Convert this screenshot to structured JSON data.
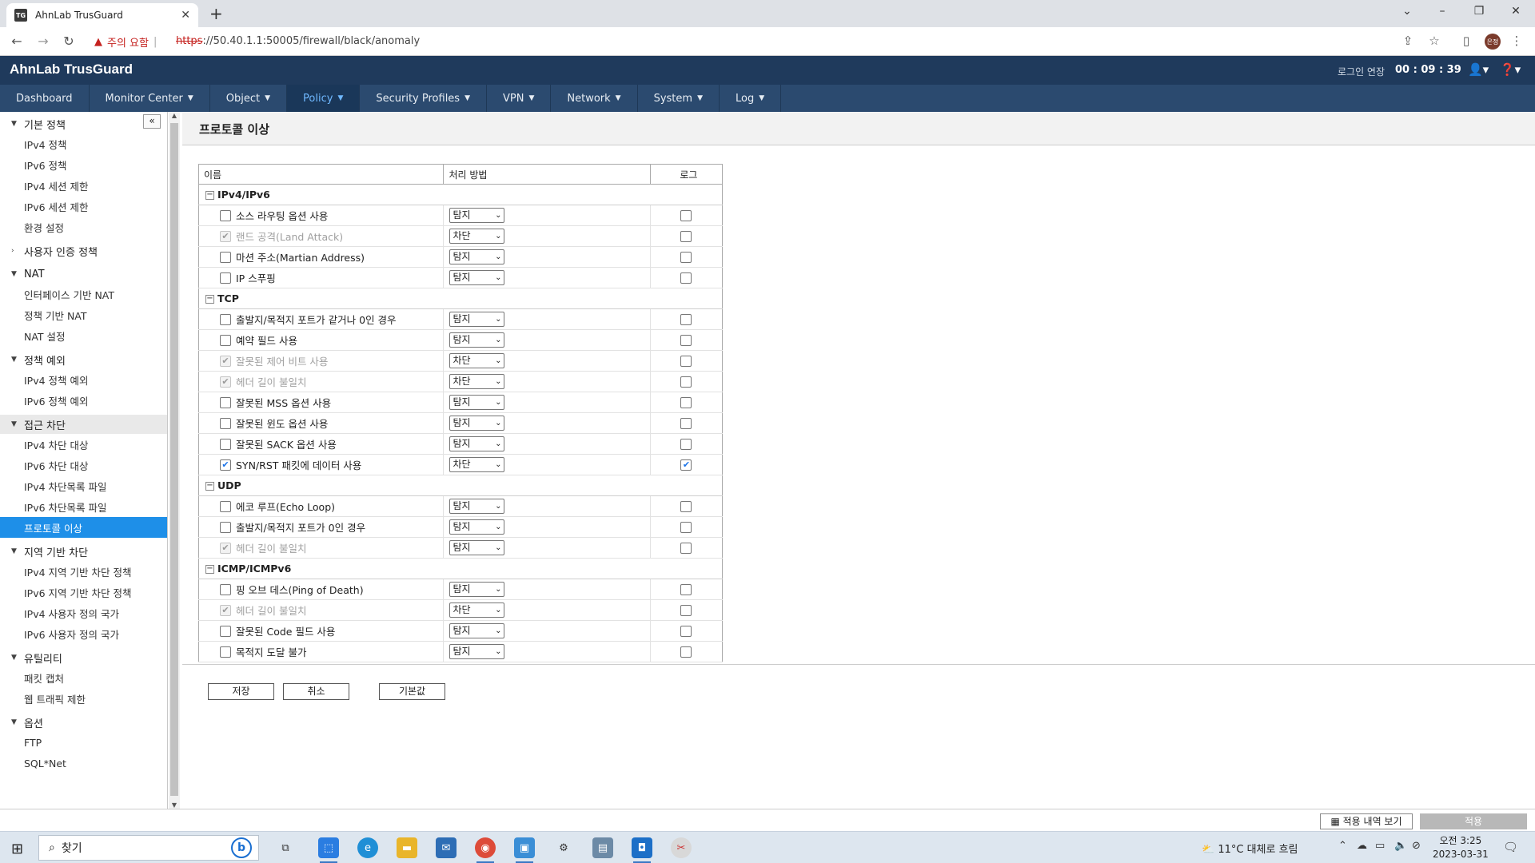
{
  "browser": {
    "tab_title": "AhnLab TrusGuard",
    "tab_favicon": "TG",
    "security_warning": "주의 요함",
    "url_scheme": "https",
    "url_rest": "://50.40.1.1:50005/firewall/black/anomaly",
    "profile": "은정"
  },
  "app": {
    "brand": "AhnLab TrusGuard",
    "relogin_label": "로그인 연장",
    "timer": "00 : 09 : 39"
  },
  "menu": [
    {
      "label": "Dashboard",
      "dropdown": false
    },
    {
      "label": "Monitor Center",
      "dropdown": true
    },
    {
      "label": "Object",
      "dropdown": true
    },
    {
      "label": "Policy",
      "dropdown": true,
      "active": true
    },
    {
      "label": "Security Profiles",
      "dropdown": true
    },
    {
      "label": "VPN",
      "dropdown": true
    },
    {
      "label": "Network",
      "dropdown": true
    },
    {
      "label": "System",
      "dropdown": true
    },
    {
      "label": "Log",
      "dropdown": true
    }
  ],
  "sidebar": {
    "collapse_label": "«",
    "groups": [
      {
        "label": "기본 정책",
        "expanded": true,
        "items": [
          "IPv4 정책",
          "IPv6 정책",
          "IPv4 세션 제한",
          "IPv6 세션 제한",
          "환경 설정"
        ]
      },
      {
        "label": "사용자 인증 정책",
        "expanded": false,
        "items": []
      },
      {
        "label": "NAT",
        "expanded": true,
        "items": [
          "인터페이스 기반 NAT",
          "정책 기반 NAT",
          "NAT 설정"
        ]
      },
      {
        "label": "정책 예외",
        "expanded": true,
        "items": [
          "IPv4 정책 예외",
          "IPv6 정책 예외"
        ]
      },
      {
        "label": "접근 차단",
        "expanded": true,
        "highlight": true,
        "items": [
          "IPv4 차단 대상",
          "IPv6 차단 대상",
          "IPv4 차단목록 파일",
          "IPv6 차단목록 파일",
          "프로토콜 이상"
        ],
        "active_item": "프로토콜 이상"
      },
      {
        "label": "지역 기반 차단",
        "expanded": true,
        "items": [
          "IPv4 지역 기반 차단 정책",
          "IPv6 지역 기반 차단 정책",
          "IPv4 사용자 정의 국가",
          "IPv6 사용자 정의 국가"
        ]
      },
      {
        "label": "유틸리티",
        "expanded": true,
        "items": [
          "패킷 캡처",
          "웹 트래픽 제한"
        ]
      },
      {
        "label": "옵션",
        "expanded": true,
        "items": [
          "FTP",
          "SQL*Net"
        ]
      }
    ]
  },
  "page": {
    "title": "프로토콜 이상",
    "columns": {
      "name": "이름",
      "action": "처리 방법",
      "log": "로그"
    },
    "sections": [
      {
        "label": "IPv4/IPv6",
        "rows": [
          {
            "name": "소스 라우팅 옵션 사용",
            "checked": false,
            "disabled": false,
            "action": "탐지",
            "log": false
          },
          {
            "name": "랜드 공격(Land Attack)",
            "checked": true,
            "disabled": true,
            "action": "차단",
            "log": false
          },
          {
            "name": "마션 주소(Martian Address)",
            "checked": false,
            "disabled": false,
            "action": "탐지",
            "log": false
          },
          {
            "name": "IP 스푸핑",
            "checked": false,
            "disabled": false,
            "action": "탐지",
            "log": false
          }
        ]
      },
      {
        "label": "TCP",
        "rows": [
          {
            "name": "출발지/목적지 포트가 같거나 0인 경우",
            "checked": false,
            "disabled": false,
            "action": "탐지",
            "log": false
          },
          {
            "name": "예약 필드 사용",
            "checked": false,
            "disabled": false,
            "action": "탐지",
            "log": false
          },
          {
            "name": "잘못된 제어 비트 사용",
            "checked": true,
            "disabled": true,
            "action": "차단",
            "log": false
          },
          {
            "name": "헤더 길이 불일치",
            "checked": true,
            "disabled": true,
            "action": "차단",
            "log": false
          },
          {
            "name": "잘못된 MSS 옵션 사용",
            "checked": false,
            "disabled": false,
            "action": "탐지",
            "log": false
          },
          {
            "name": "잘못된 윈도 옵션 사용",
            "checked": false,
            "disabled": false,
            "action": "탐지",
            "log": false
          },
          {
            "name": "잘못된 SACK 옵션 사용",
            "checked": false,
            "disabled": false,
            "action": "탐지",
            "log": false
          },
          {
            "name": "SYN/RST 패킷에 데이터 사용",
            "checked": true,
            "disabled": false,
            "action": "차단",
            "log": true
          }
        ]
      },
      {
        "label": "UDP",
        "rows": [
          {
            "name": "에코 루프(Echo Loop)",
            "checked": false,
            "disabled": false,
            "action": "탐지",
            "log": false
          },
          {
            "name": "출발지/목적지 포트가 0인 경우",
            "checked": false,
            "disabled": false,
            "action": "탐지",
            "log": false
          },
          {
            "name": "헤더 길이 불일치",
            "checked": true,
            "disabled": true,
            "action": "탐지",
            "log": false
          }
        ]
      },
      {
        "label": "ICMP/ICMPv6",
        "rows": [
          {
            "name": "핑 오브 데스(Ping of Death)",
            "checked": false,
            "disabled": false,
            "action": "탐지",
            "log": false
          },
          {
            "name": "헤더 길이 불일치",
            "checked": true,
            "disabled": true,
            "action": "차단",
            "log": false
          },
          {
            "name": "잘못된 Code 필드 사용",
            "checked": false,
            "disabled": false,
            "action": "탐지",
            "log": false
          },
          {
            "name": "목적지 도달 불가",
            "checked": false,
            "disabled": false,
            "action": "탐지",
            "log": false
          }
        ]
      }
    ],
    "buttons": {
      "save": "저장",
      "cancel": "취소",
      "default": "기본값"
    }
  },
  "action_bar": {
    "history": "적용 내역 보기",
    "apply": "적용"
  },
  "taskbar": {
    "search_placeholder": "찾기",
    "weather": "11°C 대체로 흐림",
    "time": "오전 3:25",
    "date": "2023-03-31"
  },
  "colors": {
    "header_bg": "#1f3a5c",
    "menu_bg": "#2b4a6f",
    "active_menu_text": "#6fb8ff",
    "sidebar_active": "#1e8fe8",
    "warning_red": "#c5221f"
  }
}
